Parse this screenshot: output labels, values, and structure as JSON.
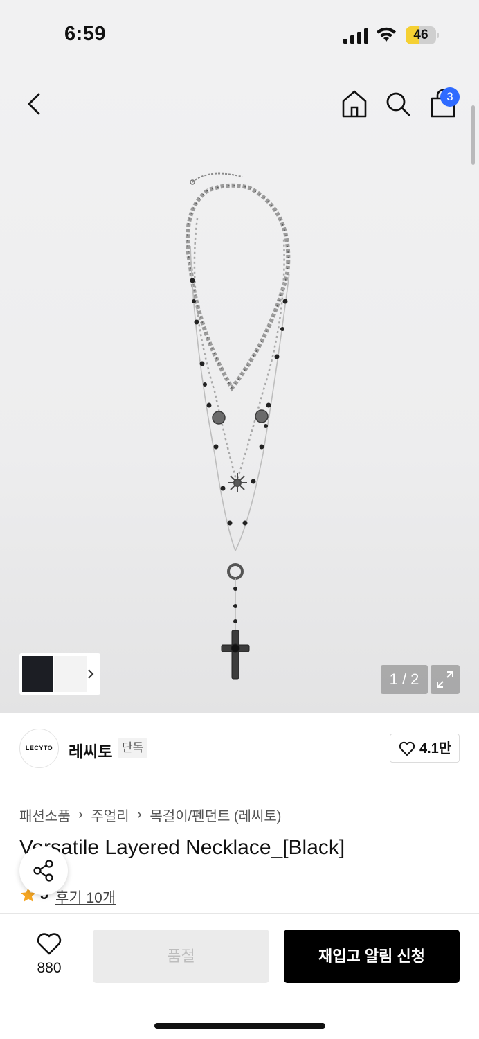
{
  "status_bar": {
    "time": "6:59",
    "battery": "46",
    "battery_level": 0.46,
    "icons": [
      "cellular-signal-icon",
      "wifi-icon",
      "battery-icon"
    ]
  },
  "nav": {
    "icons": [
      "back-chevron-icon",
      "home-icon",
      "search-icon",
      "shopping-bag-icon"
    ],
    "cart_count": "3"
  },
  "gallery": {
    "counter": "1 / 2",
    "current": 1,
    "total": 2
  },
  "brand": {
    "logo_text": "LECYTO",
    "name": "레씨토",
    "tag": "단독",
    "likes": "4.1만"
  },
  "breadcrumb": [
    "패션소품",
    "주얼리",
    "목걸이/펜던트 (레씨토)"
  ],
  "product": {
    "title": "Versatile Layered Necklace_[Black]",
    "rating": "5",
    "reviews": "후기 10개"
  },
  "bottom_bar": {
    "wish_count": "880",
    "soldout_label": "품절",
    "restock_label": "재입고 알림 신청"
  },
  "colors": {
    "accent_blue": "#2f6bff",
    "star": "#f5a623",
    "primary_button": "#000000",
    "battery_yellow": "#f5d033"
  }
}
